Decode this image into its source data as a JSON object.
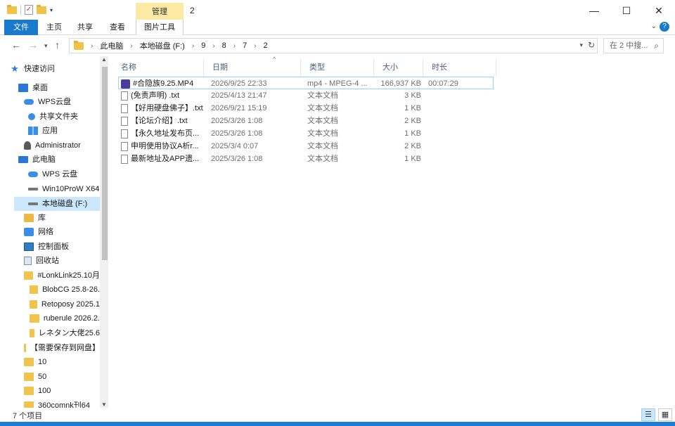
{
  "window": {
    "title": "2",
    "contextual_tab_group": "管理",
    "minimize": "—",
    "maximize": "☐",
    "close": "✕"
  },
  "ribbon": {
    "tabs": [
      "文件",
      "主页",
      "共享",
      "查看",
      "图片工具"
    ],
    "expand": "⌄",
    "help": "?"
  },
  "address": {
    "crumbs": [
      "此电脑",
      "本地磁盘 (F:)",
      "9",
      "8",
      "7",
      "2"
    ],
    "search_placeholder": "在 2 中搜..."
  },
  "sidebar": {
    "items": [
      {
        "label": "快速访问",
        "icon": "star-icon"
      },
      {
        "label": "桌面",
        "icon": "desktop-icon"
      },
      {
        "label": "WPS云盘",
        "icon": "cloud-icon"
      },
      {
        "label": "共享文件夹",
        "icon": "share-icon"
      },
      {
        "label": "应用",
        "icon": "apps-icon"
      },
      {
        "label": "Administrator",
        "icon": "user-icon"
      },
      {
        "label": "此电脑",
        "icon": "pc-icon"
      },
      {
        "label": "WPS 云盘",
        "icon": "cloud-icon"
      },
      {
        "label": "Win10ProW X64",
        "icon": "drive-icon"
      },
      {
        "label": "本地磁盘 (F:)",
        "icon": "drive-icon"
      },
      {
        "label": "库",
        "icon": "library-icon"
      },
      {
        "label": "网络",
        "icon": "network-icon"
      },
      {
        "label": "控制面板",
        "icon": "control-panel-icon"
      },
      {
        "label": "回收站",
        "icon": "recycle-bin-icon"
      },
      {
        "label": "#LonkLink25.10月",
        "icon": "folder-icon"
      },
      {
        "label": "BlobCG 25.8-26.",
        "icon": "folder-icon"
      },
      {
        "label": "Retoposy 2025.1",
        "icon": "folder-icon"
      },
      {
        "label": "ruberule 2026.2.",
        "icon": "folder-icon"
      },
      {
        "label": "レネタン大佬25.6",
        "icon": "folder-icon"
      },
      {
        "label": "【需要保存到网盘】",
        "icon": "folder-icon"
      },
      {
        "label": "10",
        "icon": "folder-icon"
      },
      {
        "label": "50",
        "icon": "folder-icon"
      },
      {
        "label": "100",
        "icon": "folder-icon"
      },
      {
        "label": "360comnk刊64",
        "icon": "folder-icon"
      }
    ],
    "selected_index": 9
  },
  "columns": [
    "名称",
    "日期",
    "类型",
    "大小",
    "时长"
  ],
  "files": [
    {
      "name": "#合隐族9.25.MP4",
      "date": "2026/9/25 22:33",
      "type": "mp4 - MPEG-4 ...",
      "size": "166,937 KB",
      "duration": "00:07:29",
      "icon": "video-file-icon"
    },
    {
      "name": "(免责声明) .txt",
      "date": "2025/4/13 21:47",
      "type": "文本文档",
      "size": "3 KB",
      "duration": "",
      "icon": "text-file-icon"
    },
    {
      "name": "【好用硬盘佛子】.txt",
      "date": "2026/9/21 15:19",
      "type": "文本文档",
      "size": "1 KB",
      "duration": "",
      "icon": "text-file-icon"
    },
    {
      "name": "【论坛介绍】.txt",
      "date": "2025/3/26 1:08",
      "type": "文本文档",
      "size": "2 KB",
      "duration": "",
      "icon": "text-file-icon"
    },
    {
      "name": "【永久地址发布页...",
      "date": "2025/3/26 1:08",
      "type": "文本文档",
      "size": "1 KB",
      "duration": "",
      "icon": "text-file-icon"
    },
    {
      "name": "申明使用协议A析r...",
      "date": "2025/3/4 0:07",
      "type": "文本文档",
      "size": "2 KB",
      "duration": "",
      "icon": "text-file-icon"
    },
    {
      "name": "最新地址及APP遗...",
      "date": "2025/3/26 1:08",
      "type": "文本文档",
      "size": "1 KB",
      "duration": "",
      "icon": "text-file-icon"
    }
  ],
  "status": {
    "item_count": "7 个项目"
  }
}
